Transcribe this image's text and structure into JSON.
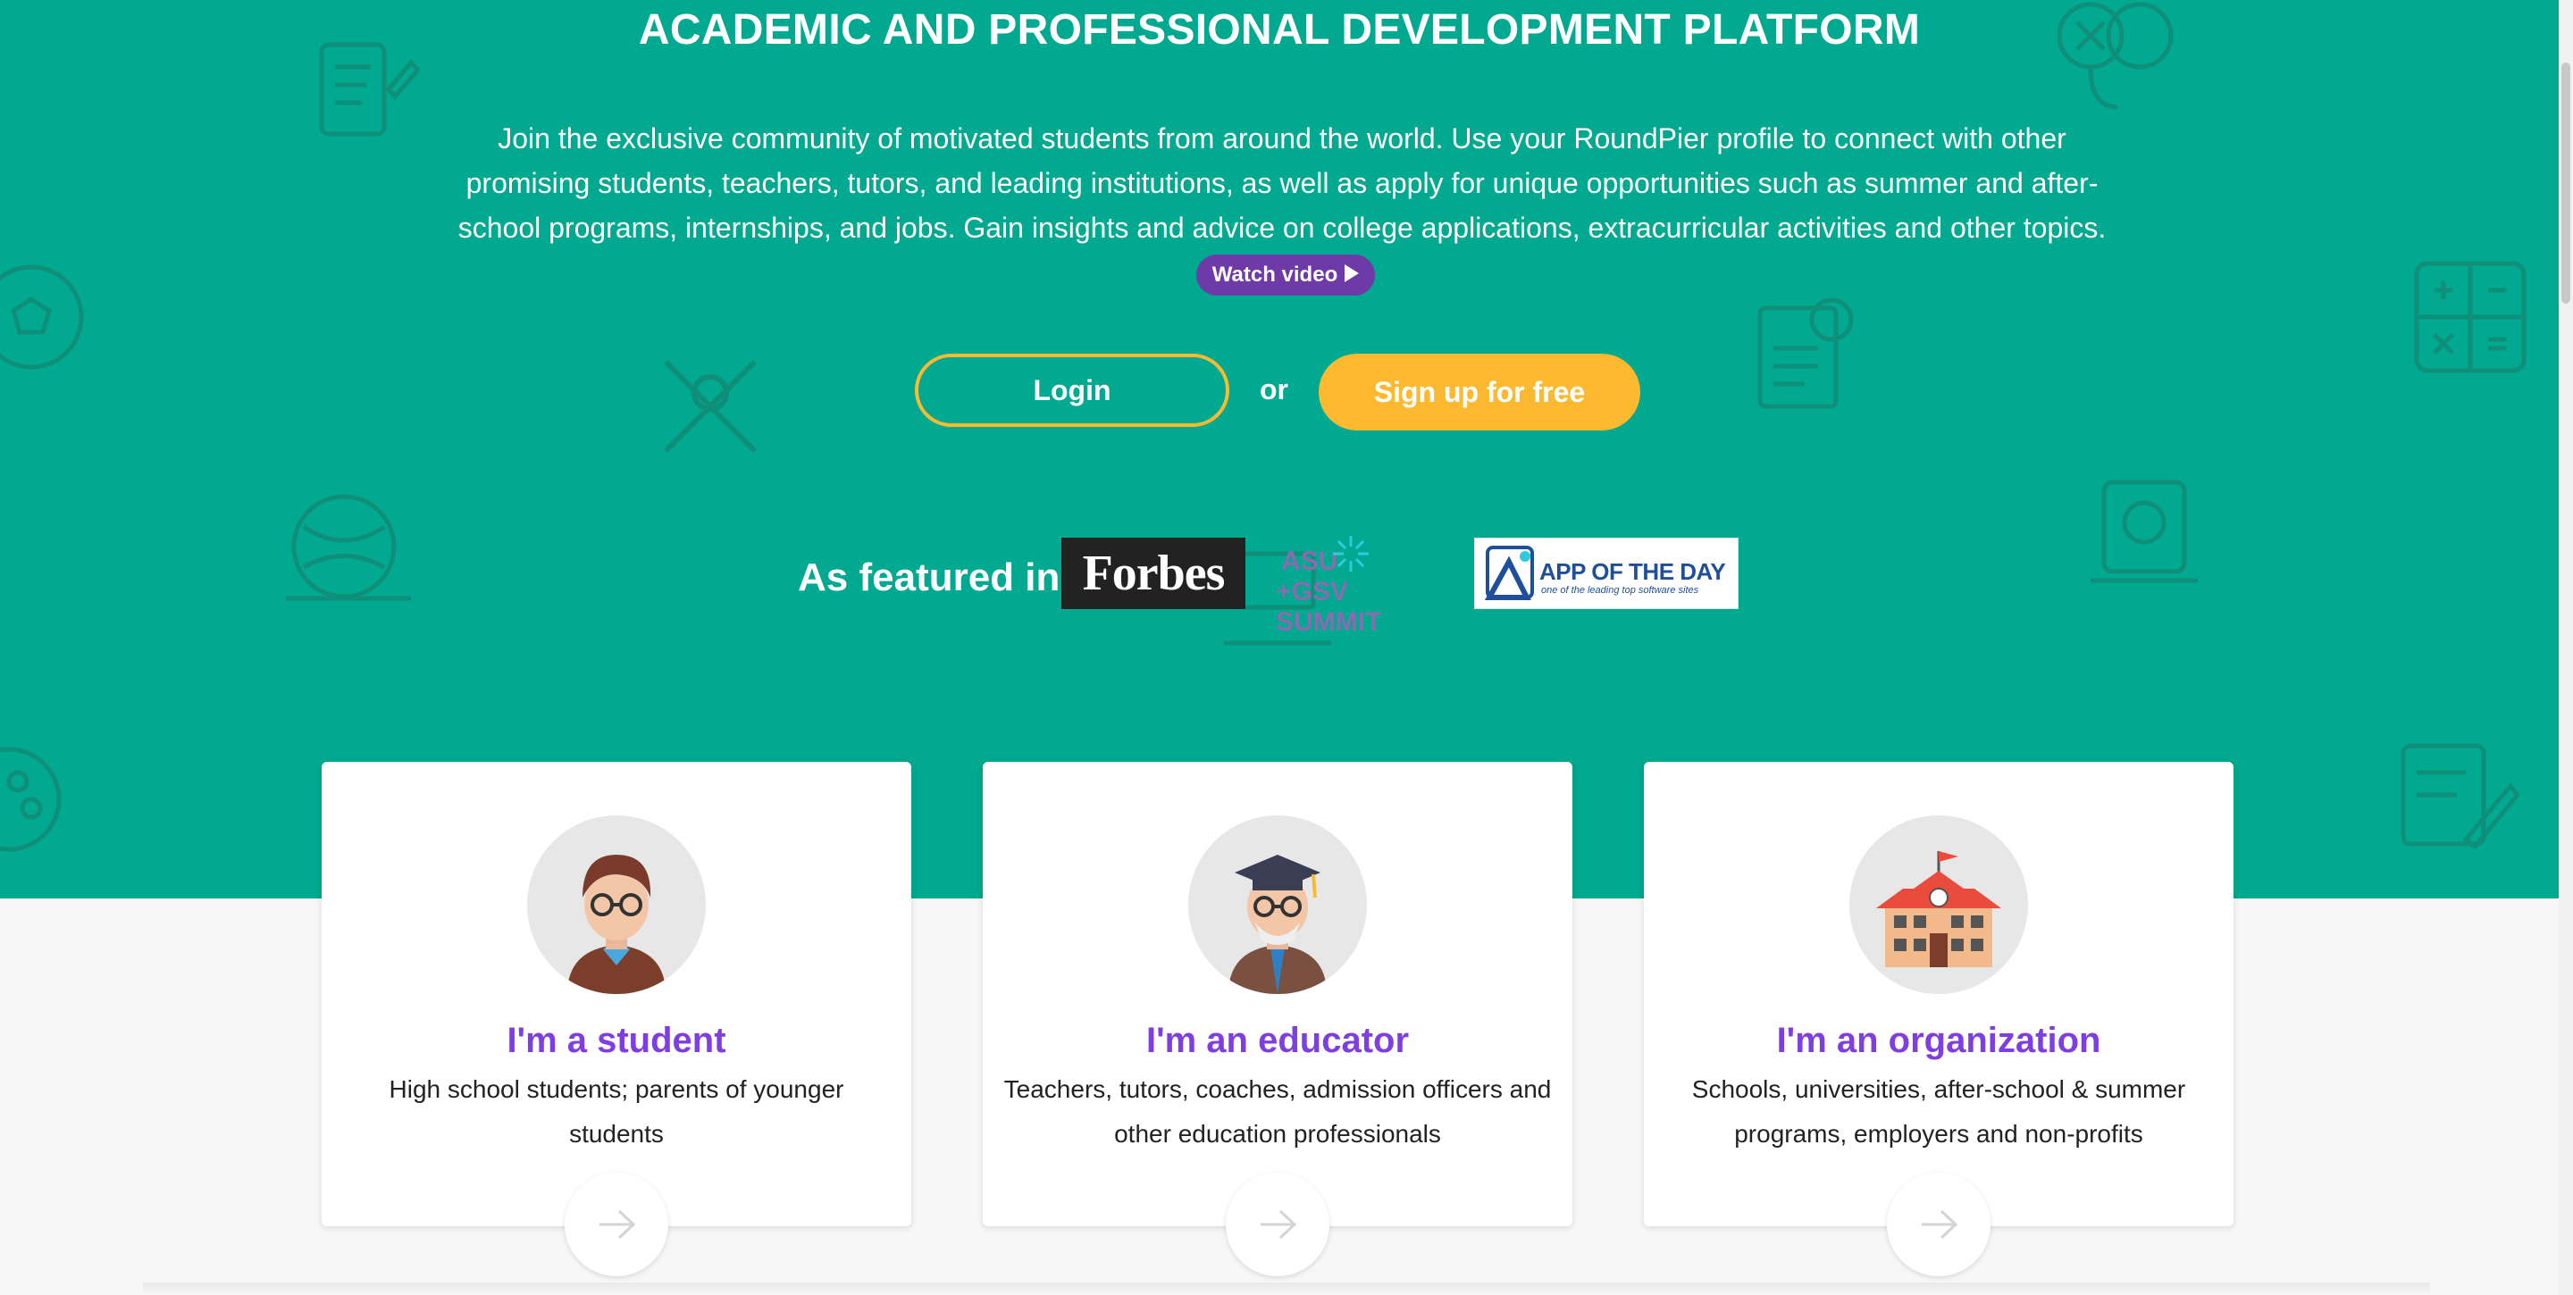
{
  "colors": {
    "hero_bg": "#00a98f",
    "accent": "#fdb92f",
    "purple": "#7f3fe0",
    "watch_bg": "#6d3aa8"
  },
  "hero": {
    "title": "ACADEMIC AND PROFESSIONAL DEVELOPMENT PLATFORM",
    "intro": "Join the exclusive community of motivated students from around the world. Use your RoundPier profile to connect with other promising students, teachers, tutors, and leading institutions, as well as apply for unique opportunities such as summer and after-school programs, internships, and jobs. Gain insights and advice on college applications, extracurricular activities and other topics.",
    "watch_video": "Watch video",
    "login": "Login",
    "or": "or",
    "signup": "Sign up for free",
    "featured_label": "As featured in",
    "featured": {
      "forbes": "Forbes",
      "asu_line1": "ASU",
      "asu_line2": "+GSV SUMMIT",
      "aotd_name": "APP OF THE DAY",
      "aotd_tag": "one of the leading top software sites"
    }
  },
  "cards": [
    {
      "title": "I'm a student",
      "description": "High school students; parents of younger students",
      "avatar": "student-avatar-icon"
    },
    {
      "title": "I'm an educator",
      "description": "Teachers, tutors, coaches, admission officers and other education professionals",
      "avatar": "educator-avatar-icon"
    },
    {
      "title": "I'm an organization",
      "description": "Schools, universities, after-school & summer programs, employers and non-profits",
      "avatar": "school-building-icon"
    }
  ],
  "icons": {
    "arrow": "arrow-right-icon"
  }
}
